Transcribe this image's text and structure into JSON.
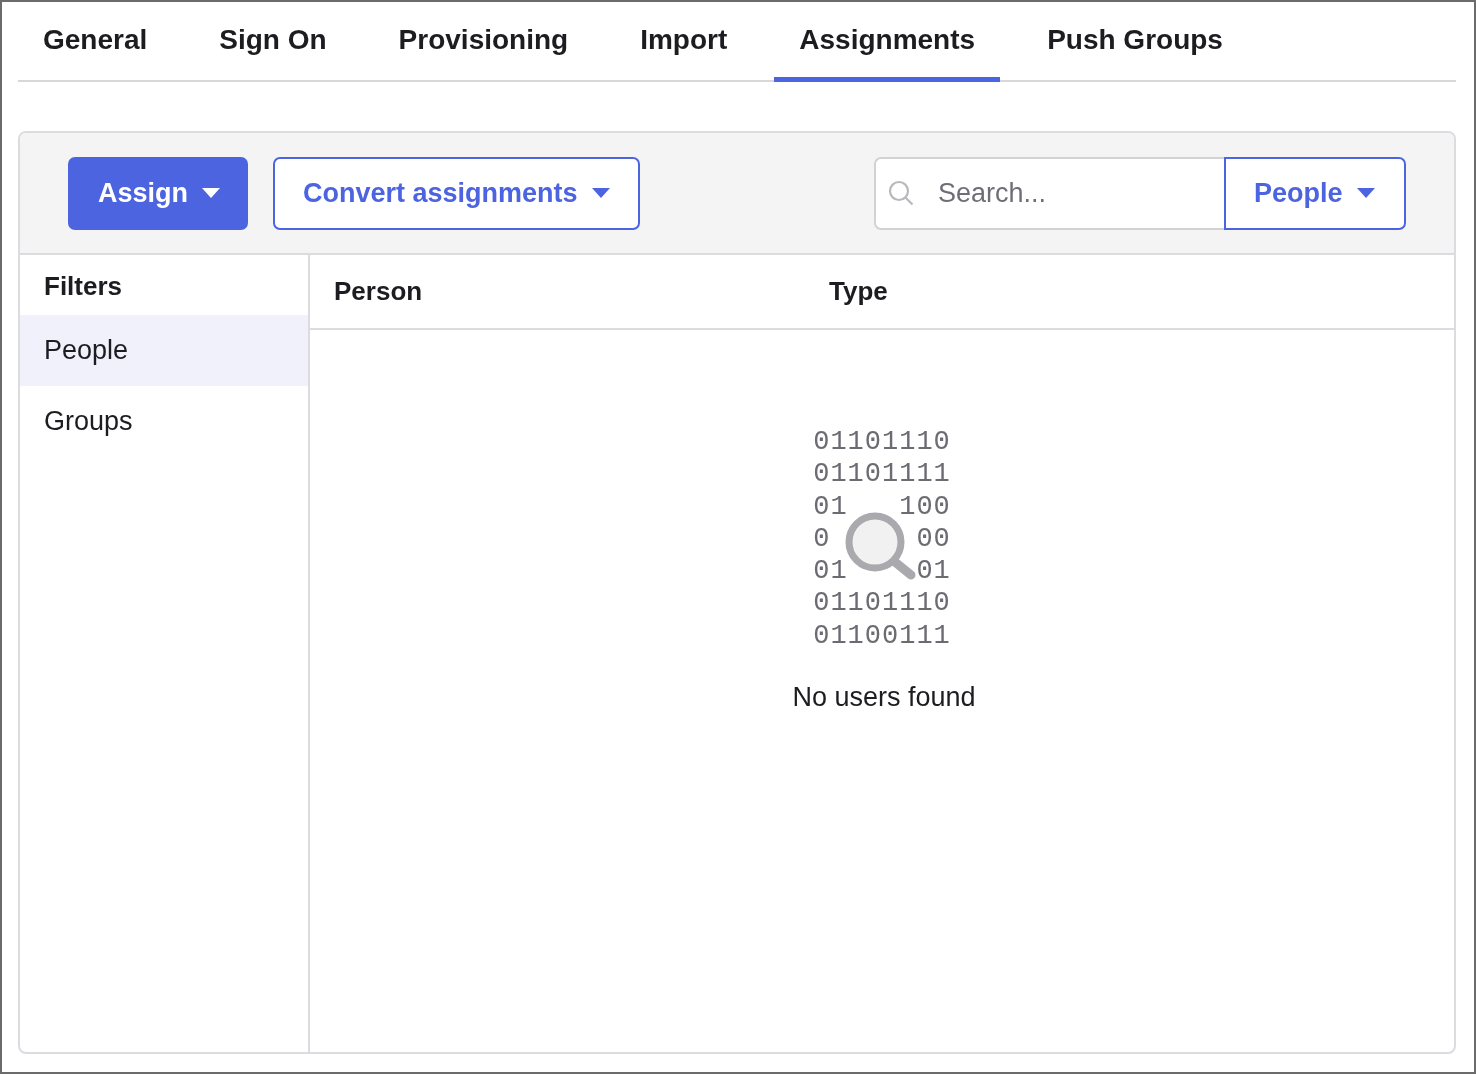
{
  "tabs": [
    {
      "label": "General",
      "selected": false
    },
    {
      "label": "Sign On",
      "selected": false
    },
    {
      "label": "Provisioning",
      "selected": false
    },
    {
      "label": "Import",
      "selected": false
    },
    {
      "label": "Assignments",
      "selected": true
    },
    {
      "label": "Push Groups",
      "selected": false
    }
  ],
  "toolbar": {
    "assign_button": "Assign",
    "convert_button": "Convert assignments",
    "search": {
      "placeholder": "Search..."
    },
    "search_scope": "People"
  },
  "filters": {
    "title": "Filters",
    "items": [
      {
        "label": "People",
        "selected": true
      },
      {
        "label": "Groups",
        "selected": false
      }
    ]
  },
  "table": {
    "columns": [
      "Person",
      "Type"
    ]
  },
  "empty_state": {
    "binary_lines": [
      "01101110",
      "01101111",
      "01   100",
      "0     00",
      "01    01",
      "01101110",
      "01100111"
    ],
    "message": "No users found"
  }
}
